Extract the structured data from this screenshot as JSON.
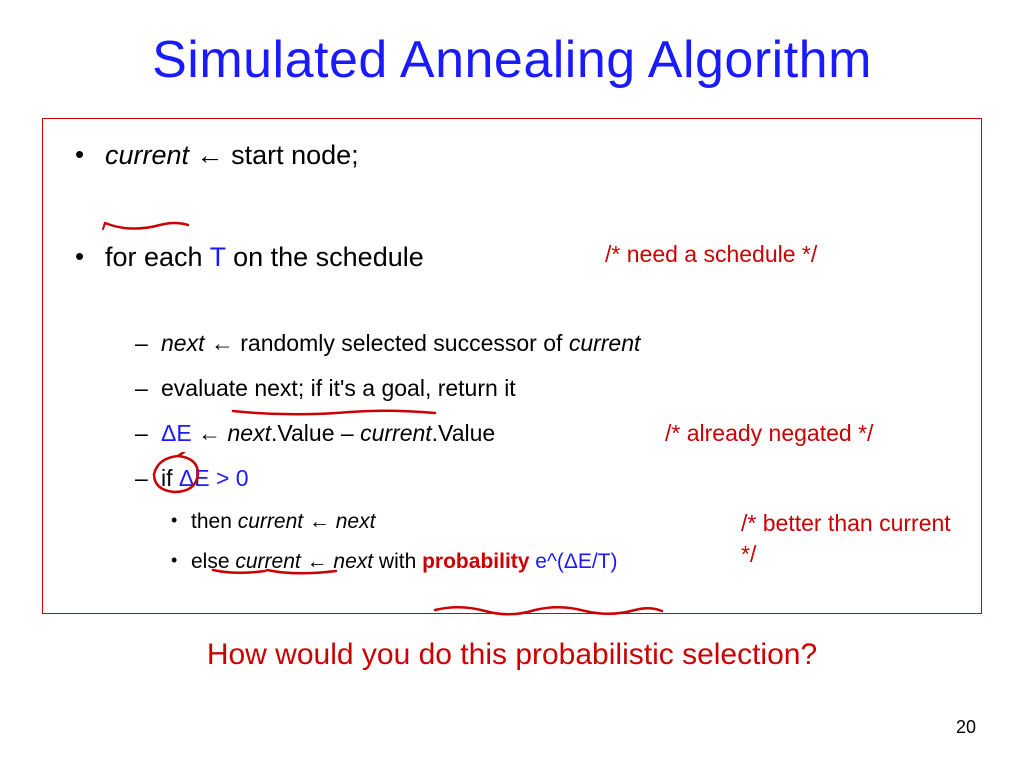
{
  "title": "Simulated Annealing Algorithm",
  "line1_current": "current",
  "line1_arrow": " ← ",
  "line1_rest": "start node;",
  "line2_fore": "for each ",
  "line2_T": "T",
  "line2_rest": " on the schedule",
  "comment_schedule": "/* need a schedule */",
  "sub1_next": "next",
  "sub1_arrow": " ← ",
  "sub1_rest": "randomly selected successor of ",
  "sub1_current": "current",
  "sub2": "evaluate next; if it's a goal, return it",
  "sub3_dE": "ΔE",
  "sub3_arrow": "  ← ",
  "sub3_next": "next",
  "sub3_dot1": ".Value – ",
  "sub3_current": "current",
  "sub3_dot2": ".Value",
  "comment_negated": "/* already negated */",
  "sub4_if": "if ",
  "sub4_cond": "ΔE > 0",
  "deep1_then": "then ",
  "deep1_current": "current",
  "deep1_arrow": " ← ",
  "deep1_next": "next",
  "comment_better": "/* better than current */",
  "deep2_else": "else ",
  "deep2_current": "current",
  "deep2_arrow": " ← ",
  "deep2_next": "next",
  "deep2_with": " with ",
  "deep2_prob": "probability",
  "deep2_exp": " e^(ΔE/T)",
  "footer_question": "How would you do this probabilistic selection?",
  "page_number": "20"
}
